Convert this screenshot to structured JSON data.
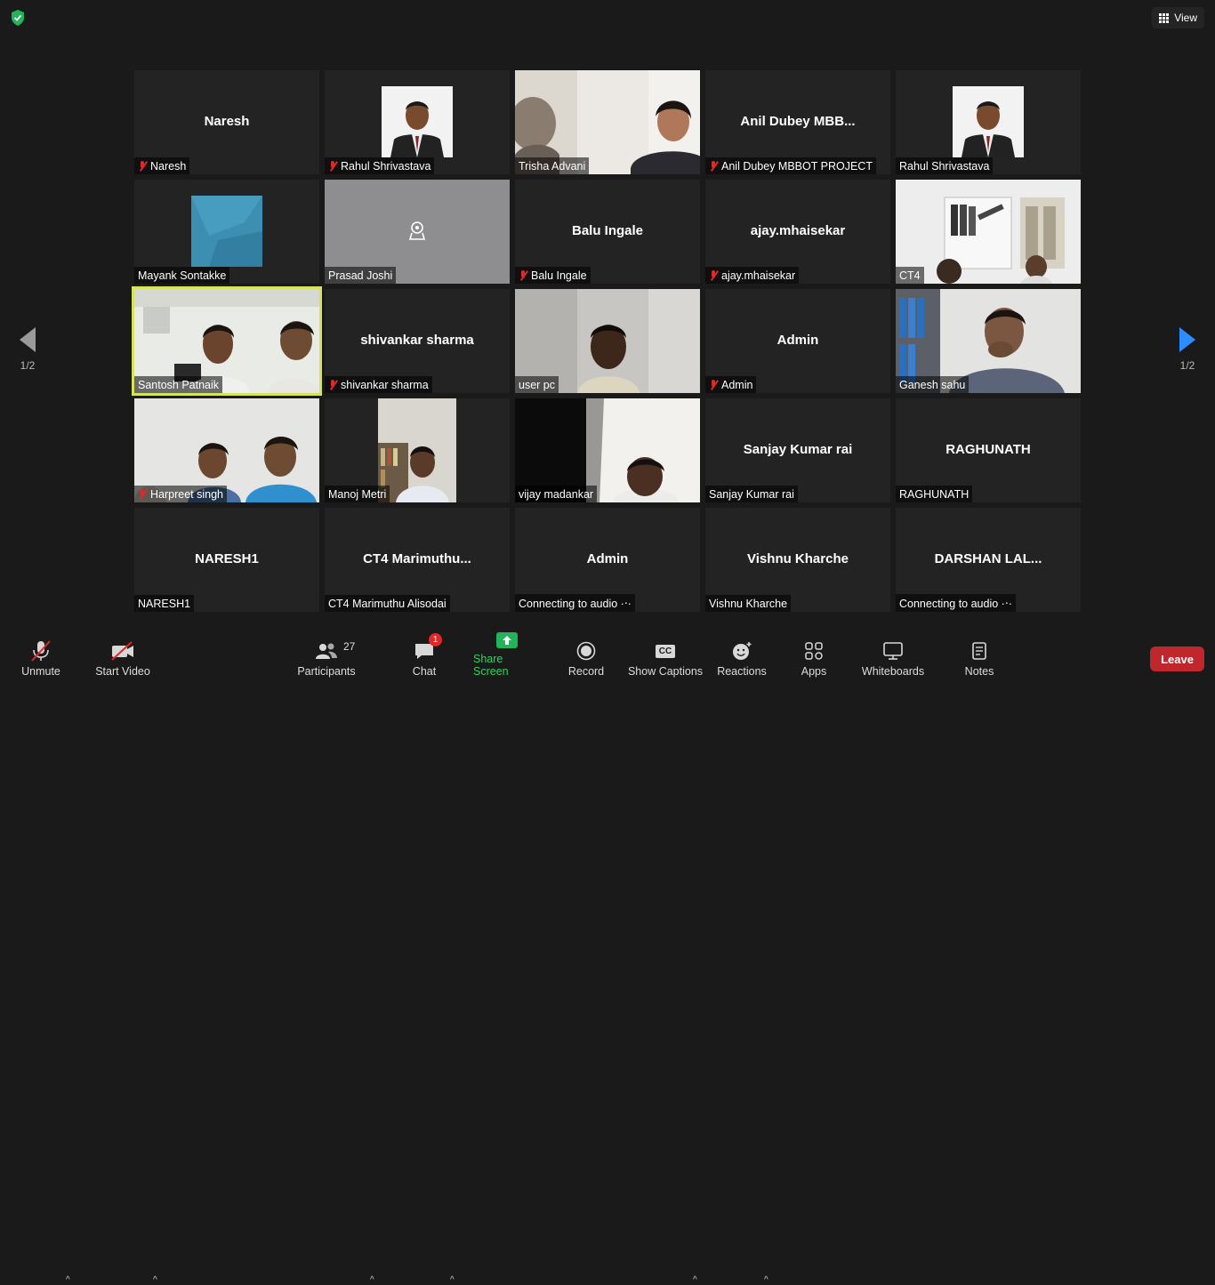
{
  "top": {
    "view_label": "View"
  },
  "pager": {
    "left_text": "1/2",
    "right_text": "1/2"
  },
  "tiles": [
    {
      "label": "Naresh",
      "center": "Naresh",
      "muted": true
    },
    {
      "label": "Rahul Shrivastava",
      "center": "",
      "muted": true
    },
    {
      "label": "Trisha Advani",
      "center": "",
      "muted": false
    },
    {
      "label": "Anil Dubey MBBOT PROJECT",
      "center": "Anil  Dubey  MBB...",
      "muted": true
    },
    {
      "label": "Rahul Shrivastava",
      "center": "",
      "muted": false
    },
    {
      "label": "Mayank Sontakke",
      "center": "",
      "muted": false
    },
    {
      "label": "Prasad Joshi",
      "center": "",
      "muted": false
    },
    {
      "label": "Balu Ingale",
      "center": "Balu Ingale",
      "muted": true
    },
    {
      "label": "ajay.mhaisekar",
      "center": "ajay.mhaisekar",
      "muted": true
    },
    {
      "label": "CT4",
      "center": "",
      "muted": false
    },
    {
      "label": "Santosh Patnaik",
      "center": "",
      "muted": false
    },
    {
      "label": "shivankar sharma",
      "center": "shivankar sharma",
      "muted": true
    },
    {
      "label": "user pc",
      "center": "",
      "muted": false
    },
    {
      "label": "Admin",
      "center": "Admin",
      "muted": true
    },
    {
      "label": "Ganesh  sahu",
      "center": "",
      "muted": false
    },
    {
      "label": "Harpreet singh",
      "center": "",
      "muted": true
    },
    {
      "label": "Manoj Metri",
      "center": "",
      "muted": false
    },
    {
      "label": "vijay madankar",
      "center": "",
      "muted": false
    },
    {
      "label": "Sanjay Kumar rai",
      "center": "Sanjay Kumar rai",
      "muted": false
    },
    {
      "label": "RAGHUNATH",
      "center": "RAGHUNATH",
      "muted": false
    },
    {
      "label": "NARESH1",
      "center": "NARESH1",
      "muted": false
    },
    {
      "label": "CT4 Marimuthu Alisodai",
      "center": "CT4  Marimuthu...",
      "muted": false
    },
    {
      "label": "Connecting to audio ·‧·",
      "center": "Admin",
      "muted": false
    },
    {
      "label": "Vishnu Kharche",
      "center": "Vishnu Kharche",
      "muted": false
    },
    {
      "label": "Connecting to audio ·‧·",
      "center": "DARSHAN  LAL...",
      "muted": false
    }
  ],
  "toolbar": {
    "unmute": "Unmute",
    "start_video": "Start Video",
    "participants": "Participants",
    "participants_count": "27",
    "chat": "Chat",
    "chat_badge": "1",
    "share_screen": "Share Screen",
    "record": "Record",
    "show_captions": "Show Captions",
    "reactions": "Reactions",
    "apps": "Apps",
    "whiteboards": "Whiteboards",
    "notes": "Notes",
    "leave": "Leave",
    "captions_icon_text": "CC"
  },
  "colors": {
    "background": "#1a1a1a",
    "tile": "#232323",
    "active_speaker": "#d7e35a",
    "share_green": "#2fd55e",
    "leave_red": "#c0272d",
    "muted_red": "#e02828",
    "accent_blue": "#2d8cff"
  }
}
